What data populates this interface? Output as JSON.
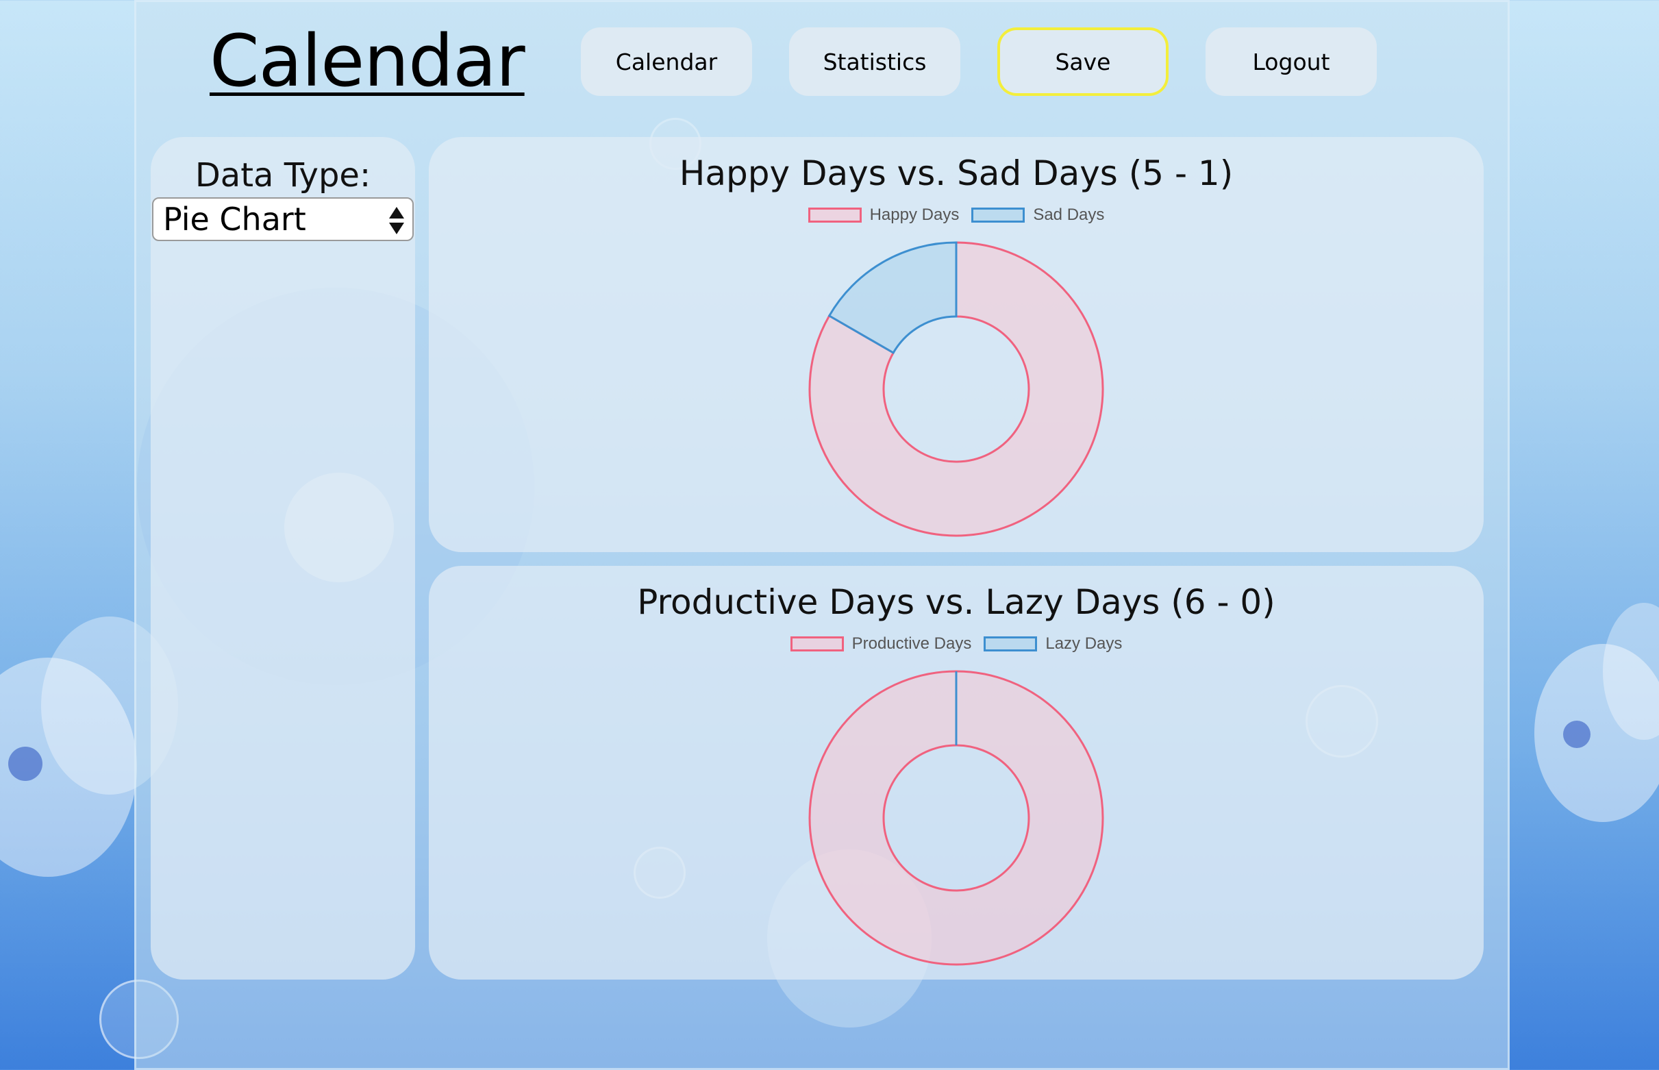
{
  "header": {
    "title": "Calendar",
    "nav": [
      {
        "label": "Calendar"
      },
      {
        "label": "Statistics"
      },
      {
        "label": "Save",
        "active": true
      },
      {
        "label": "Logout"
      }
    ]
  },
  "sidebar": {
    "label": "Data Type:",
    "select_value": "Pie Chart"
  },
  "colors": {
    "pink_border": "#f0627f",
    "pink_fill": "rgba(255,192,205,0.45)",
    "blue_border": "#3d8fd0",
    "blue_fill": "rgba(170,210,235,0.55)",
    "active_outline": "#f3ee3c"
  },
  "chart_data": [
    {
      "type": "pie",
      "title": "Happy Days vs. Sad Days (5 - 1)",
      "categories": [
        "Happy Days",
        "Sad Days"
      ],
      "values": [
        5,
        1
      ],
      "legend": "top"
    },
    {
      "type": "pie",
      "title": "Productive Days vs. Lazy Days (6 - 0)",
      "categories": [
        "Productive Days",
        "Lazy Days"
      ],
      "values": [
        6,
        0
      ],
      "legend": "top"
    }
  ]
}
